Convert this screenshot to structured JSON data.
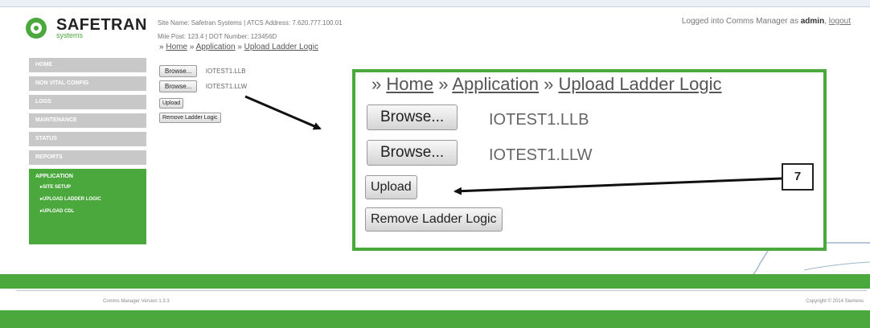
{
  "header": {
    "brand": "SAFETRAN",
    "brand_sub": "systems",
    "site_info": "Site Name: Safetran Systems | ATCS Address: 7.620.777.100.01",
    "mile_post": "Mile Post:  123.4          | DOT Number:  123456D",
    "login_prefix": "Logged into Comms Manager as ",
    "login_user": "admin",
    "logout_label": "logout"
  },
  "breadcrumb": {
    "sep": "»",
    "home": "Home",
    "application": "Application",
    "current": "Upload Ladder Logic"
  },
  "nav": {
    "items": [
      "HOME",
      "NON VITAL CONFIG",
      "LOGS",
      "MAINTENANCE",
      "STATUS",
      "REPORTS"
    ],
    "active_section": "APPLICATION",
    "sub_items": [
      "SITE SETUP",
      "UPLOAD LADDER LOGIC",
      "UPLOAD CDL"
    ]
  },
  "form": {
    "browse_label": "Browse...",
    "file1": "IOTEST1.LLB",
    "file2": "IOTEST1.LLW",
    "upload_label": "Upload",
    "remove_label": "Remove Ladder Logic"
  },
  "annotation": {
    "callout": "7"
  },
  "footer": {
    "version": "Comms Manager Version 1.3.3",
    "copyright": "Copyright © 2014 Siemens"
  },
  "colors": {
    "accent_green": "#4aa83c",
    "nav_gray": "#c8c8c8",
    "footer_line": "#b9c7d4"
  }
}
